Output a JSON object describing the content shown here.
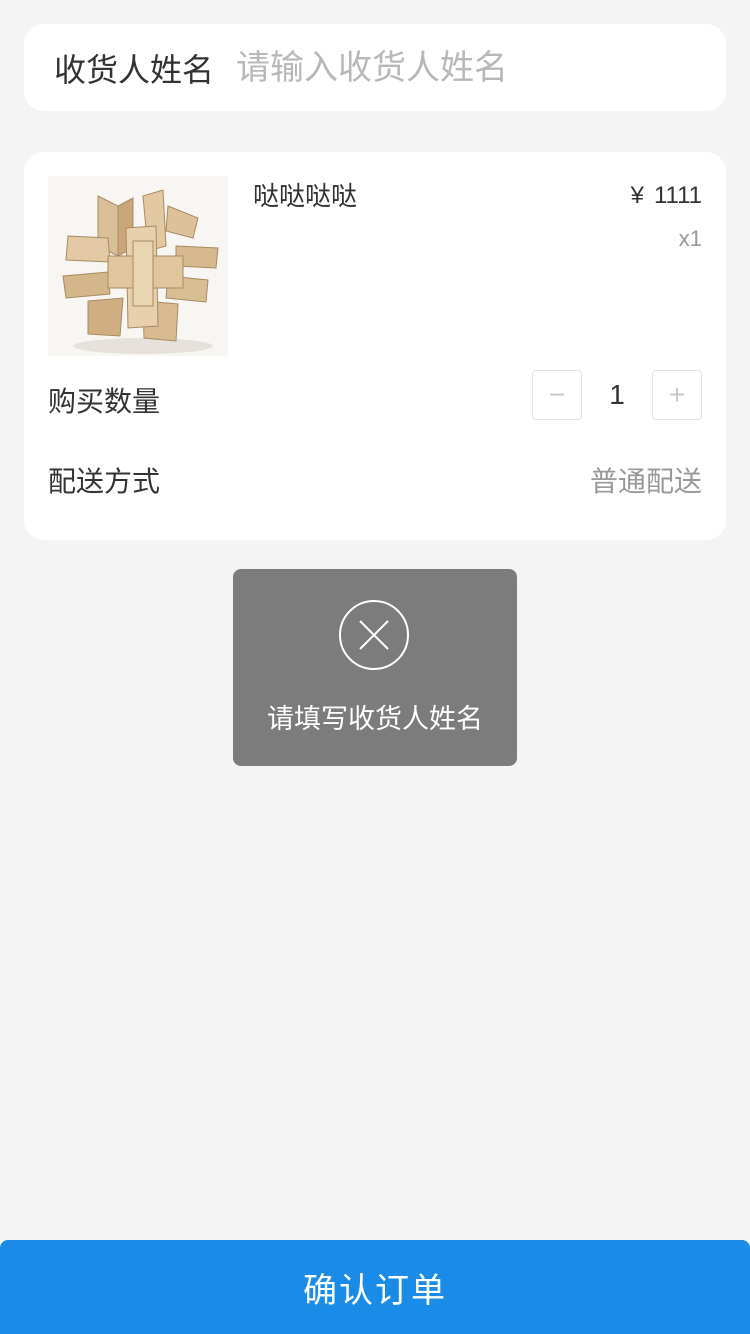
{
  "receiver": {
    "label": "收货人姓名",
    "placeholder": "请输入收货人姓名",
    "value": ""
  },
  "product": {
    "image_alt": "wooden-puzzle-image",
    "title": "哒哒哒哒",
    "currency": "¥",
    "price": "1111",
    "quantity_tag": "x1"
  },
  "purchase": {
    "quantity_label": "购买数量",
    "minus_symbol": "−",
    "plus_symbol": "+",
    "quantity": "1"
  },
  "shipping": {
    "label": "配送方式",
    "value": "普通配送"
  },
  "toast": {
    "icon": "close-circle-icon",
    "message": "请填写收货人姓名"
  },
  "footer": {
    "confirm_label": "确认订单"
  },
  "colors": {
    "accent": "#1a8ce8",
    "background": "#f4f4f4",
    "toast_bg": "#7f7f7f"
  }
}
